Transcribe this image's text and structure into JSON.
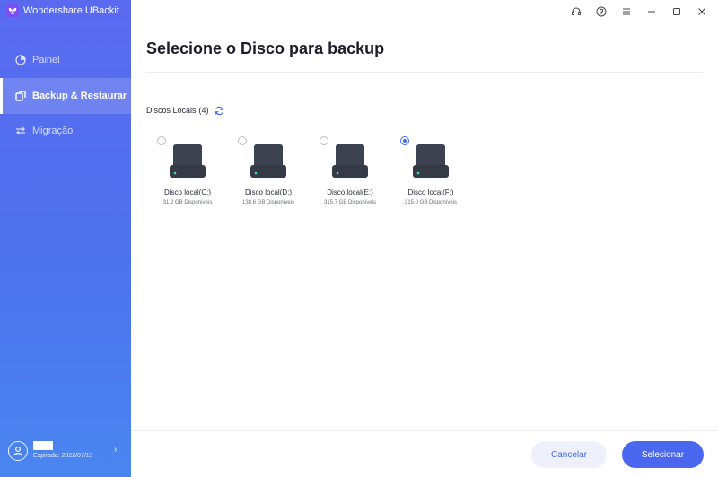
{
  "app": {
    "title": "Wondershare UBackit"
  },
  "sidebar": {
    "items": [
      {
        "label": "Painel",
        "icon": "pie-chart-icon",
        "active": false
      },
      {
        "label": "Backup & Restaurar",
        "icon": "backup-icon",
        "active": true
      },
      {
        "label": "Migração",
        "icon": "migration-arrows-icon",
        "active": false
      }
    ],
    "user": {
      "expiry": "Expirada: 2022/07/13"
    }
  },
  "window_controls": [
    "headset-icon",
    "help-icon",
    "menu-icon",
    "minimize-icon",
    "maximize-icon",
    "close-icon"
  ],
  "main": {
    "title": "Selecione o Disco para backup",
    "section_label": "Discos Locais",
    "section_count": "(4)",
    "disks": [
      {
        "name": "Disco local(C:)",
        "free": "31.2 GB Disponíveis",
        "selected": false
      },
      {
        "name": "Disco local(D:)",
        "free": "138.6 GB Disponíveis",
        "selected": false
      },
      {
        "name": "Disco local(E:)",
        "free": "315.7 GB Disponíveis",
        "selected": false
      },
      {
        "name": "Disco local(F:)",
        "free": "315.0 GB Disponíveis",
        "selected": true
      }
    ]
  },
  "footer": {
    "cancel_label": "Cancelar",
    "select_label": "Selecionar"
  },
  "colors": {
    "accent": "#4a67ef",
    "sidebar_top": "#5a6af0",
    "sidebar_bottom": "#4a86f0",
    "drive_body": "#3d4250",
    "drive_led": "#2ee6a0"
  }
}
